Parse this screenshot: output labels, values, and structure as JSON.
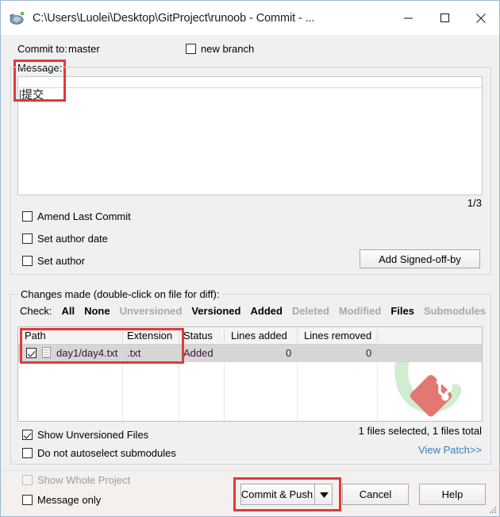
{
  "window": {
    "title": "C:\\Users\\Luolei\\Desktop\\GitProject\\runoob - Commit - ...",
    "icon": "tortoisegit-icon",
    "minimize": "minimize-icon",
    "maximize": "maximize-icon",
    "close": "close-icon"
  },
  "commit": {
    "commit_to_label": "Commit to:",
    "branch": "master",
    "new_branch_label": "new branch",
    "new_branch_checked": false,
    "message_label": "Message:",
    "message_value": "提交",
    "spell_counter": "1/3"
  },
  "options": {
    "amend_last_commit": "Amend Last Commit",
    "amend_checked": false,
    "set_author_date": "Set author date",
    "set_author_date_checked": false,
    "set_author": "Set author",
    "set_author_checked": false,
    "add_signed_off_by": "Add Signed-off-by"
  },
  "changes": {
    "group_label": "Changes made (double-click on file for diff):",
    "check_label": "Check:",
    "filters": [
      {
        "label": "All",
        "enabled": true
      },
      {
        "label": "None",
        "enabled": true
      },
      {
        "label": "Unversioned",
        "enabled": false
      },
      {
        "label": "Versioned",
        "enabled": true
      },
      {
        "label": "Added",
        "enabled": true
      },
      {
        "label": "Deleted",
        "enabled": false
      },
      {
        "label": "Modified",
        "enabled": false
      },
      {
        "label": "Files",
        "enabled": true
      },
      {
        "label": "Submodules",
        "enabled": false
      }
    ],
    "columns": [
      "Path",
      "Extension",
      "Status",
      "Lines added",
      "Lines removed"
    ],
    "rows": [
      {
        "checked": true,
        "path": "day1/day4.txt",
        "extension": ".txt",
        "status": "Added",
        "lines_added": "0",
        "lines_removed": "0"
      }
    ],
    "show_unversioned_files": "Show Unversioned Files",
    "show_unversioned_checked": true,
    "do_not_autoselect_submodules": "Do not autoselect submodules",
    "do_not_autoselect_checked": false,
    "files_status": "1 files selected, 1 files total",
    "view_patch": "View Patch>>"
  },
  "footer": {
    "show_whole_project": "Show Whole Project",
    "show_whole_project_enabled": false,
    "show_whole_project_checked": false,
    "message_only": "Message only",
    "message_only_checked": false,
    "commit_button": "Commit & Push",
    "commit_dropdown": "chevron-down-icon",
    "cancel_button": "Cancel",
    "help_button": "Help"
  },
  "colors": {
    "accent_red": "#e03a3a",
    "link_blue": "#3a7fbf",
    "row_select": "#d6d6d6"
  }
}
